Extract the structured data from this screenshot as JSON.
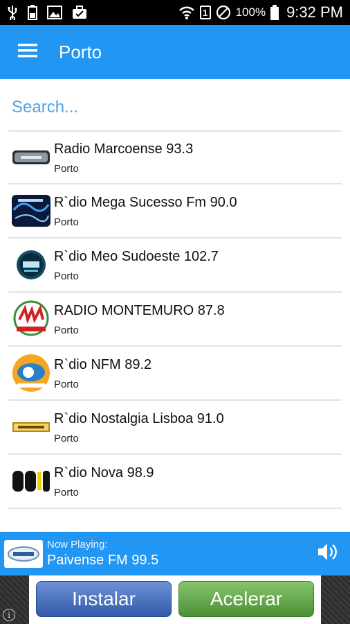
{
  "status_bar": {
    "battery_text": "100%",
    "sim_label": "1",
    "time": "9:32 PM",
    "icons": [
      "usb-icon",
      "battery-icon",
      "image-icon",
      "briefcase-icon",
      "wifi-icon",
      "sim-icon",
      "do-not-disturb-icon"
    ]
  },
  "appbar": {
    "title": "Porto",
    "menu_icon": "hamburger-menu-icon",
    "color": "#2196f3"
  },
  "search": {
    "placeholder": "Search...",
    "value": ""
  },
  "stations": [
    {
      "title": "Radio Marcoense 93.3",
      "subtitle": "Porto",
      "logo": "radio-marcoense-logo"
    },
    {
      "title": "R`dio Mega Sucesso Fm 90.0",
      "subtitle": "Porto",
      "logo": "radio-mega-sucesso-logo"
    },
    {
      "title": "R`dio Meo Sudoeste 102.7",
      "subtitle": "Porto",
      "logo": "radio-meo-sudoeste-logo"
    },
    {
      "title": "RADIO MONTEMURO 87.8",
      "subtitle": "Porto",
      "logo": "radio-montemuro-logo"
    },
    {
      "title": "R`dio NFM 89.2",
      "subtitle": "Porto",
      "logo": "radio-nfm-logo"
    },
    {
      "title": "R`dio Nostalgia Lisboa 91.0",
      "subtitle": "Porto",
      "logo": "radio-nostalgia-logo"
    },
    {
      "title": "R`dio Nova 98.9",
      "subtitle": "Porto",
      "logo": "radio-nova-logo"
    }
  ],
  "now_playing": {
    "label": "Now Playing:",
    "title": "Paivense FM 99.5",
    "volume_icon": "volume-icon"
  },
  "ad": {
    "install_label": "Instalar",
    "accelerate_label": "Acelerar",
    "info_label": "i"
  }
}
